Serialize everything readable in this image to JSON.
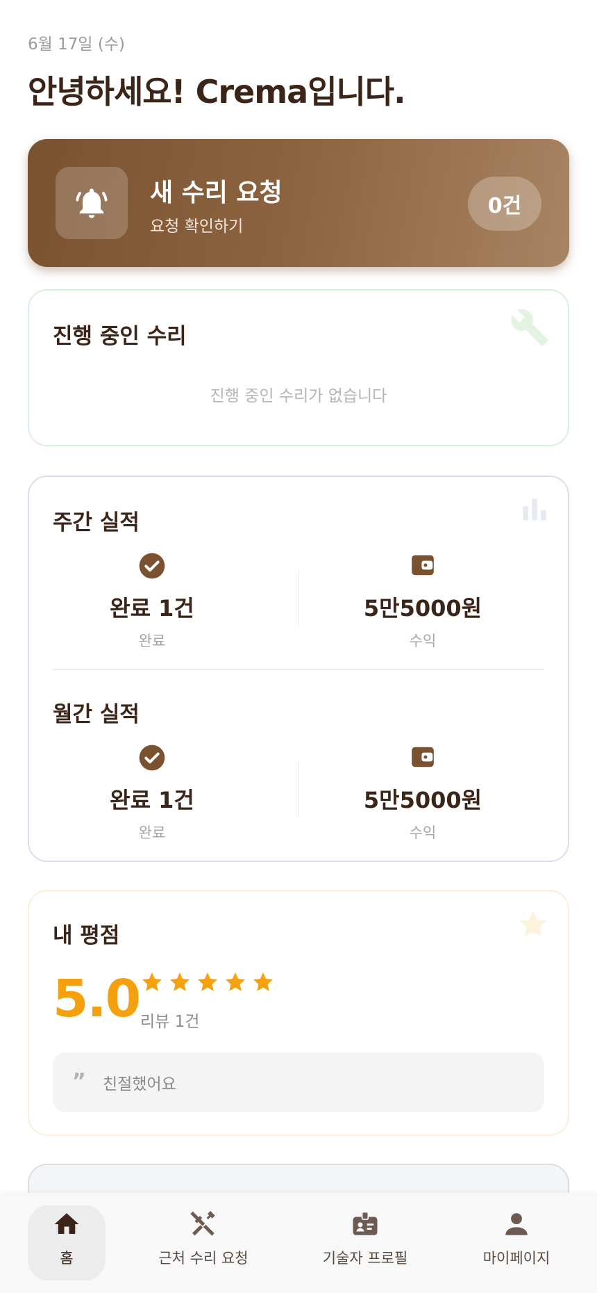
{
  "header": {
    "date": "6월 17일 (수)",
    "greeting": "안녕하세요! Crema입니다."
  },
  "banner": {
    "title": "새 수리 요청",
    "subtitle": "요청 확인하기",
    "count": "0건",
    "icon": "bell-icon"
  },
  "in_progress": {
    "title": "진행 중인 수리",
    "empty_text": "진행 중인 수리가 없습니다",
    "icon": "wrench-icon"
  },
  "stats": {
    "icon": "bar-chart-icon",
    "weekly": {
      "title": "주간 실적",
      "completed_value": "완료 1건",
      "completed_label": "완료",
      "earnings_value": "5만5000원",
      "earnings_label": "수익"
    },
    "monthly": {
      "title": "월간 실적",
      "completed_value": "완료 1건",
      "completed_label": "완료",
      "earnings_value": "5만5000원",
      "earnings_label": "수익"
    }
  },
  "rating": {
    "title": "내 평점",
    "score": "5.0",
    "stars": 5,
    "review_count": "리뷰 1건",
    "latest_review": "친절했어요",
    "icon": "star-icon"
  },
  "nav": {
    "home": "홈",
    "nearby": "근처 수리 요청",
    "profile": "기술자 프로필",
    "mypage": "마이페이지"
  },
  "colors": {
    "brand_brown": "#7a5230",
    "text_dark": "#3b2418",
    "star_orange": "#f5a00f"
  }
}
